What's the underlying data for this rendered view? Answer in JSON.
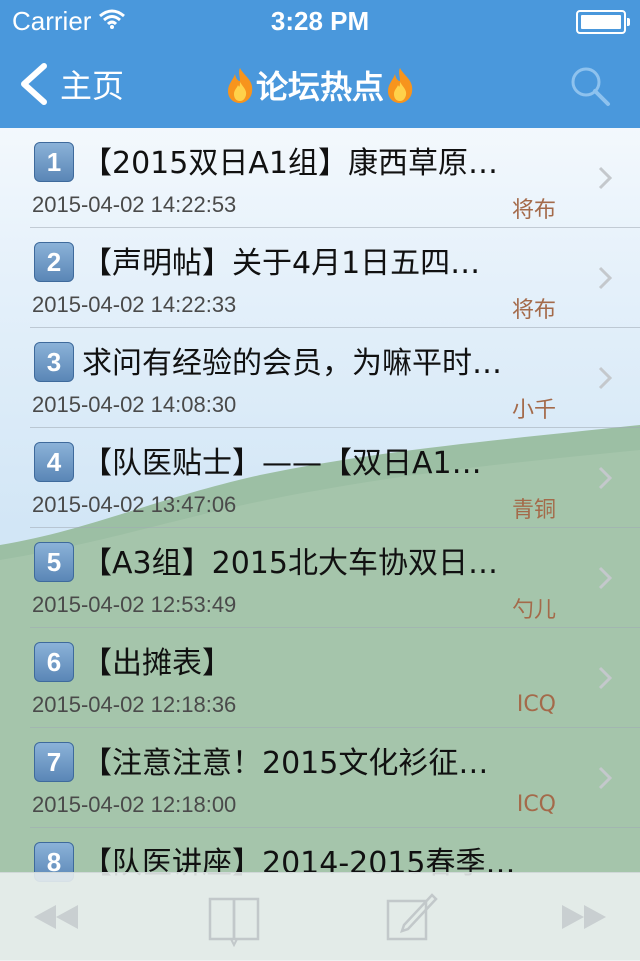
{
  "status_bar": {
    "carrier": "Carrier",
    "time": "3:28 PM"
  },
  "nav": {
    "back_label": "主页",
    "title": "论坛热点"
  },
  "posts": [
    {
      "num": "1",
      "title": "【2015双日A1组】康西草原…",
      "date": "2015-04-02 14:22:53",
      "author": "将布"
    },
    {
      "num": "2",
      "title": "【声明帖】关于4月1日五四…",
      "date": "2015-04-02 14:22:33",
      "author": "将布"
    },
    {
      "num": "3",
      "title": "求问有经验的会员，为嘛平时…",
      "date": "2015-04-02 14:08:30",
      "author": "小千"
    },
    {
      "num": "4",
      "title": "【队医贴士】——【双日A1…",
      "date": "2015-04-02 13:47:06",
      "author": "青铜"
    },
    {
      "num": "5",
      "title": "【A3组】2015北大车协双日…",
      "date": "2015-04-02 12:53:49",
      "author": "勺儿"
    },
    {
      "num": "6",
      "title": "【出摊表】",
      "date": "2015-04-02 12:18:36",
      "author": "ICQ"
    },
    {
      "num": "7",
      "title": "【注意注意！2015文化衫征…",
      "date": "2015-04-02 12:18:00",
      "author": "ICQ"
    },
    {
      "num": "8",
      "title": "【队医讲座】2014-2015春季…",
      "date": "",
      "author": ""
    }
  ],
  "colors": {
    "nav_bar": "#4a98dc",
    "author_text": "#a46a4a",
    "number_badge": "#6a92c0"
  },
  "icons": {
    "back": "chevron-left-icon",
    "title": "fire-icon",
    "search": "search-icon",
    "row": "chevron-right-icon",
    "toolbar": [
      "rewind-icon",
      "book-icon",
      "compose-icon",
      "fast-forward-icon"
    ]
  }
}
